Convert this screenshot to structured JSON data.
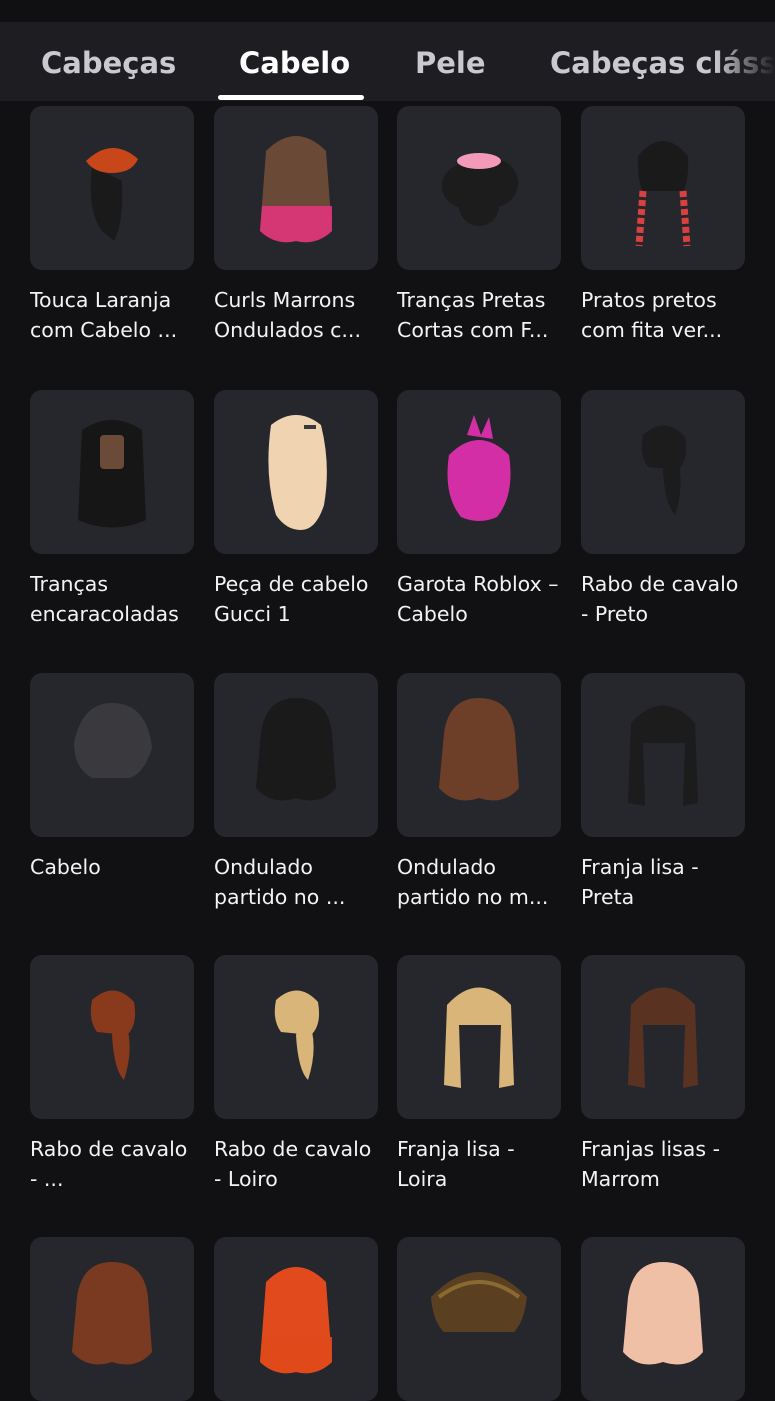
{
  "tabs": [
    {
      "label": "Cabeças"
    },
    {
      "label": "Cabelo"
    },
    {
      "label": "Pele"
    },
    {
      "label": "Cabeças clássicas"
    }
  ],
  "active_tab": "Cabelo",
  "items": [
    {
      "name": "Touca Laranja com Cabelo ...",
      "icon": "orange-beanie-hair-icon",
      "color": "#1a1a1a",
      "accent": "#c8471a",
      "style": "beanie"
    },
    {
      "name": "Curls Marrons Ondulados c...",
      "icon": "brown-pink-ombre-hair-icon",
      "color": "#6a4a36",
      "accent": "#e0357a",
      "style": "long"
    },
    {
      "name": "Tranças Pretas Cortas com F...",
      "icon": "black-curls-pink-bow-hair-icon",
      "color": "#1c1c1c",
      "accent": "#f29ab8",
      "style": "curls"
    },
    {
      "name": "Pratos pretos com fita ver...",
      "icon": "black-braids-red-ribbon-hair-icon",
      "color": "#1a1a1a",
      "accent": "#d94040",
      "style": "braids"
    },
    {
      "name": "Tranças encaracoladas",
      "icon": "curly-braids-hair-icon",
      "color": "#161616",
      "accent": "#6b4a3a",
      "style": "locs"
    },
    {
      "name": "Peça de cabelo Gucci 1",
      "icon": "blonde-wavy-hair-icon",
      "color": "#f0d4b2",
      "accent": "#3a3a3a",
      "style": "wavy"
    },
    {
      "name": "Garota Roblox – Cabelo",
      "icon": "pink-hair-icon",
      "color": "#d42ea6",
      "accent": "#d42ea6",
      "style": "pink"
    },
    {
      "name": "Rabo de cavalo - Preto",
      "icon": "black-ponytail-hair-icon",
      "color": "#1c1c1c",
      "accent": "#1c1c1c",
      "style": "ponytail"
    },
    {
      "name": "Cabelo",
      "icon": "dark-grey-hair-icon",
      "color": "#3a3a3e",
      "accent": "#3a3a3e",
      "style": "puffy"
    },
    {
      "name": "Ondulado partido no ...",
      "icon": "black-wavy-bob-hair-icon",
      "color": "#1a1a1a",
      "accent": "#1a1a1a",
      "style": "bob"
    },
    {
      "name": "Ondulado partido no m...",
      "icon": "brown-wavy-bob-hair-icon",
      "color": "#6e3f28",
      "accent": "#6e3f28",
      "style": "bob"
    },
    {
      "name": "Franja lisa - Preta",
      "icon": "black-straight-bangs-hair-icon",
      "color": "#1c1c1c",
      "accent": "#1c1c1c",
      "style": "bangs"
    },
    {
      "name": "Rabo de cavalo - ...",
      "icon": "red-ponytail-hair-icon",
      "color": "#8a3a1c",
      "accent": "#8a3a1c",
      "style": "ponytail"
    },
    {
      "name": "Rabo de cavalo - Loiro",
      "icon": "blonde-ponytail-hair-icon",
      "color": "#d9b57a",
      "accent": "#d9b57a",
      "style": "ponytail"
    },
    {
      "name": "Franja lisa - Loira",
      "icon": "blonde-straight-bangs-hair-icon",
      "color": "#d9b57a",
      "accent": "#d9b57a",
      "style": "bangs"
    },
    {
      "name": "Franjas lisas - Marrom",
      "icon": "brown-straight-bangs-hair-icon",
      "color": "#5a3222",
      "accent": "#5a3222",
      "style": "bangs"
    },
    {
      "name": "",
      "icon": "auburn-messy-hair-icon",
      "color": "#7a3a22",
      "accent": "#7a3a22",
      "style": "bob"
    },
    {
      "name": "",
      "icon": "orange-braided-hair-icon",
      "color": "#e04a1c",
      "accent": "#e04a1c",
      "style": "long"
    },
    {
      "name": "",
      "icon": "brown-slick-hair-icon",
      "color": "#5a4020",
      "accent": "#8a6a30",
      "style": "slick"
    },
    {
      "name": "",
      "icon": "pink-blonde-bob-hair-icon",
      "color": "#f0c0a6",
      "accent": "#f0c0a6",
      "style": "bob"
    }
  ]
}
